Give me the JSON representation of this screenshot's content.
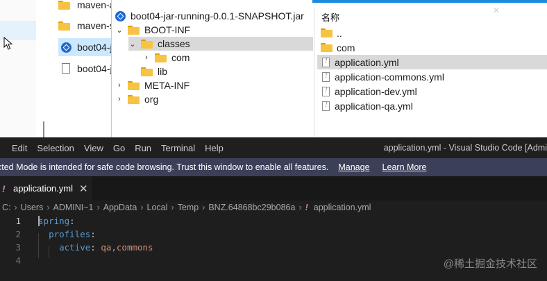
{
  "explorer_bg": {
    "items": [
      {
        "label": "maven-a",
        "icon": "folder-icon"
      },
      {
        "label": "maven-s",
        "icon": "folder-icon"
      },
      {
        "label": "boot04-j",
        "icon": "jar-icon"
      },
      {
        "label": "boot04-j",
        "icon": "file-icon"
      }
    ]
  },
  "archive": {
    "tree": [
      {
        "label": "boot04-jar-running-0.0.1-SNAPSHOT.jar",
        "icon": "jar-icon",
        "caret": ""
      },
      {
        "label": "BOOT-INF",
        "icon": "folder-icon",
        "caret": "⌄"
      },
      {
        "label": "classes",
        "icon": "folder-icon",
        "caret": "⌄"
      },
      {
        "label": "com",
        "icon": "folder-icon",
        "caret": "›"
      },
      {
        "label": "lib",
        "icon": "folder-icon",
        "caret": ""
      },
      {
        "label": "META-INF",
        "icon": "folder-icon",
        "caret": "›"
      },
      {
        "label": "org",
        "icon": "folder-icon",
        "caret": "›"
      }
    ],
    "list_header": "名称",
    "list": [
      {
        "label": "..",
        "icon": "folder-icon"
      },
      {
        "label": "com",
        "icon": "folder-icon"
      },
      {
        "label": "application.yml",
        "icon": "yml-file-icon"
      },
      {
        "label": "application-commons.yml",
        "icon": "yml-file-icon"
      },
      {
        "label": "application-dev.yml",
        "icon": "yml-file-icon"
      },
      {
        "label": "application-qa.yml",
        "icon": "yml-file-icon"
      }
    ]
  },
  "vscode": {
    "menu": [
      "Edit",
      "Selection",
      "View",
      "Go",
      "Run",
      "Terminal",
      "Help"
    ],
    "window_title": "application.yml - Visual Studio Code [Admi",
    "restricted_message": "cted Mode is intended for safe code browsing. Trust this window to enable all features.",
    "manage_label": "Manage",
    "learn_more_label": "Learn More",
    "tab": {
      "bang": "!",
      "title": "application.yml",
      "close": "✕"
    },
    "breadcrumb": [
      "C:",
      "Users",
      "ADMINI~1",
      "AppData",
      "Local",
      "Temp",
      "BNZ.64868bc29b086a"
    ],
    "breadcrumb_file_bang": "!",
    "breadcrumb_file": "application.yml",
    "code": [
      {
        "n": "1",
        "indent": "",
        "key": "spring",
        "colon": ":",
        "value": ""
      },
      {
        "n": "2",
        "indent": "  ",
        "key": "profiles",
        "colon": ":",
        "value": ""
      },
      {
        "n": "3",
        "indent": "    ",
        "key": "active",
        "colon": ":",
        "value": " qa,commons"
      },
      {
        "n": "4",
        "indent": "",
        "key": "",
        "colon": "",
        "value": ""
      }
    ]
  },
  "watermark": "@稀土掘金技术社区",
  "colors": {
    "accent": "#1a8be0",
    "restricted_bar": "#3b3f58",
    "yaml_key": "#569cd6",
    "yaml_value": "#ce9178",
    "yaml_bang": "#c586c0"
  }
}
